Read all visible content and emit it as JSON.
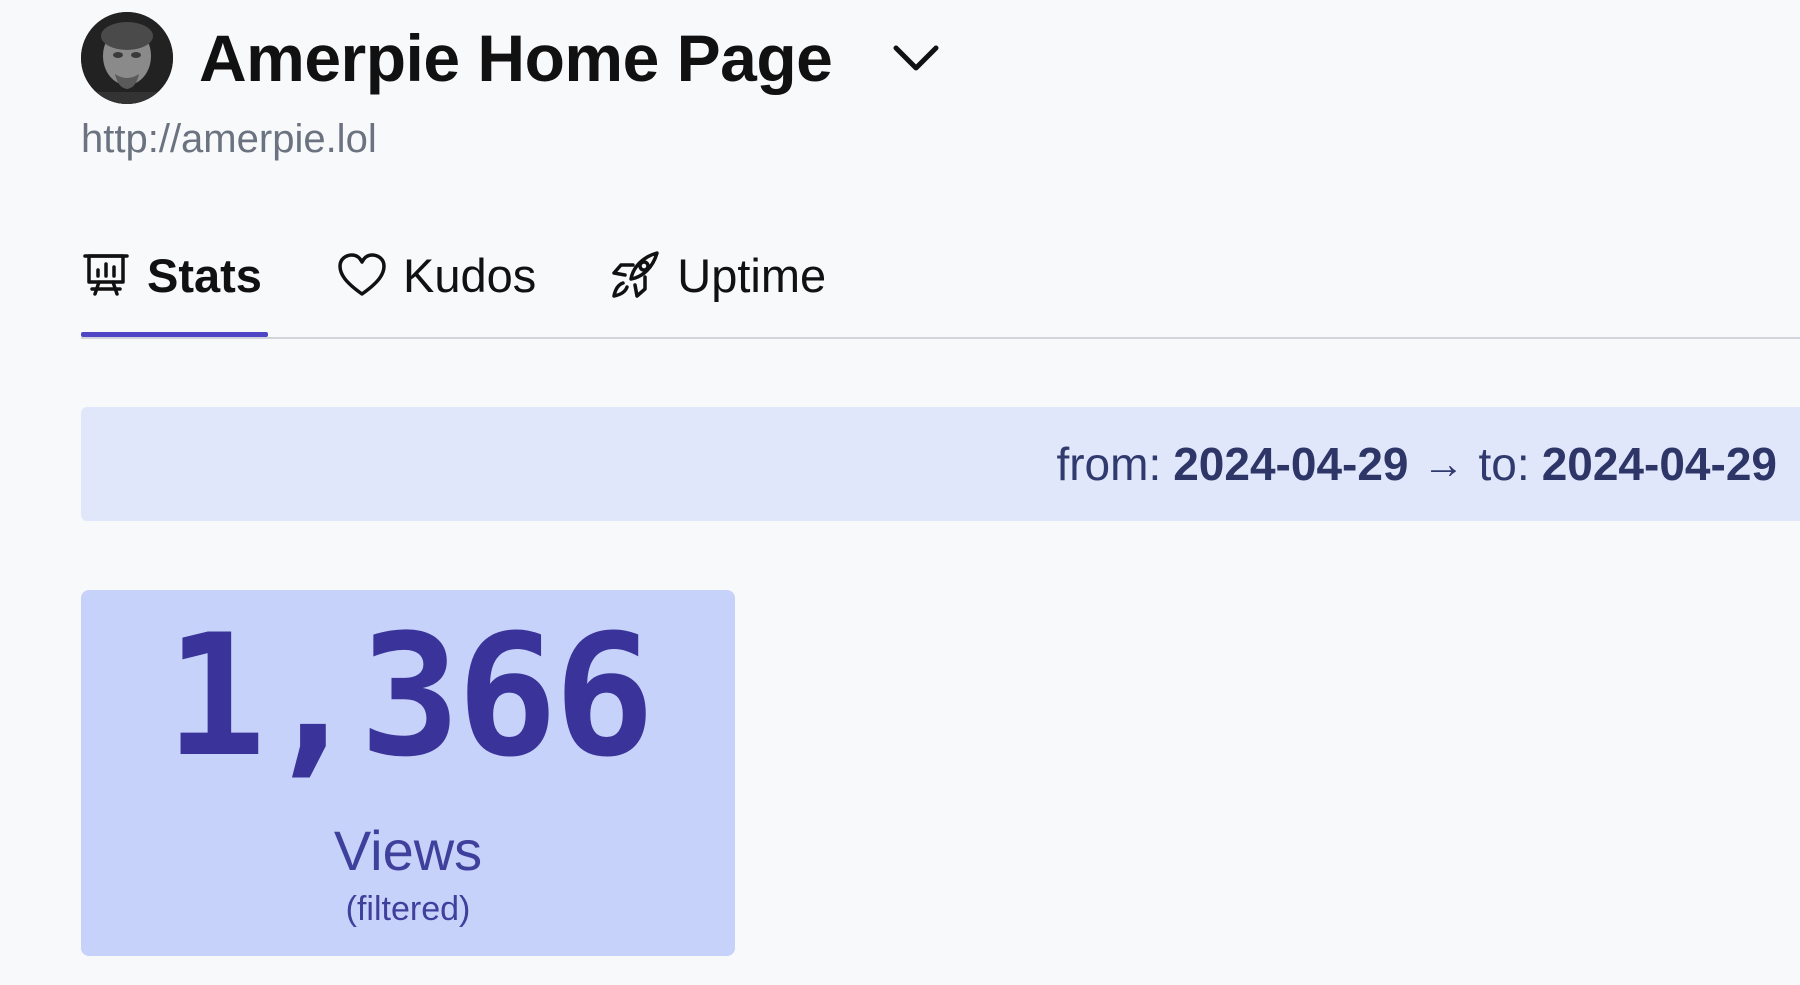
{
  "site": {
    "title": "Amerpie Home Page",
    "url": "http://amerpie.lol",
    "avatar_icon": "user-avatar-photo",
    "dropdown_icon": "chevron-down-icon"
  },
  "tabs": [
    {
      "label": "Stats",
      "icon": "presentation-chart-icon",
      "active": true
    },
    {
      "label": "Kudos",
      "icon": "heart-icon",
      "active": false
    },
    {
      "label": "Uptime",
      "icon": "rocket-icon",
      "active": false
    }
  ],
  "date_filter": {
    "from_label": "from:",
    "from_date": "2024-04-29",
    "arrow": "→",
    "to_label": "to:",
    "to_date": "2024-04-29"
  },
  "views_card": {
    "count": "1,366",
    "label": "Views",
    "sublabel": "(filtered)"
  },
  "colors": {
    "accent": "#4f46c5",
    "date_bar_bg": "#e0e7fb",
    "card_bg": "#c7d2fa",
    "card_text": "#3a349a"
  }
}
